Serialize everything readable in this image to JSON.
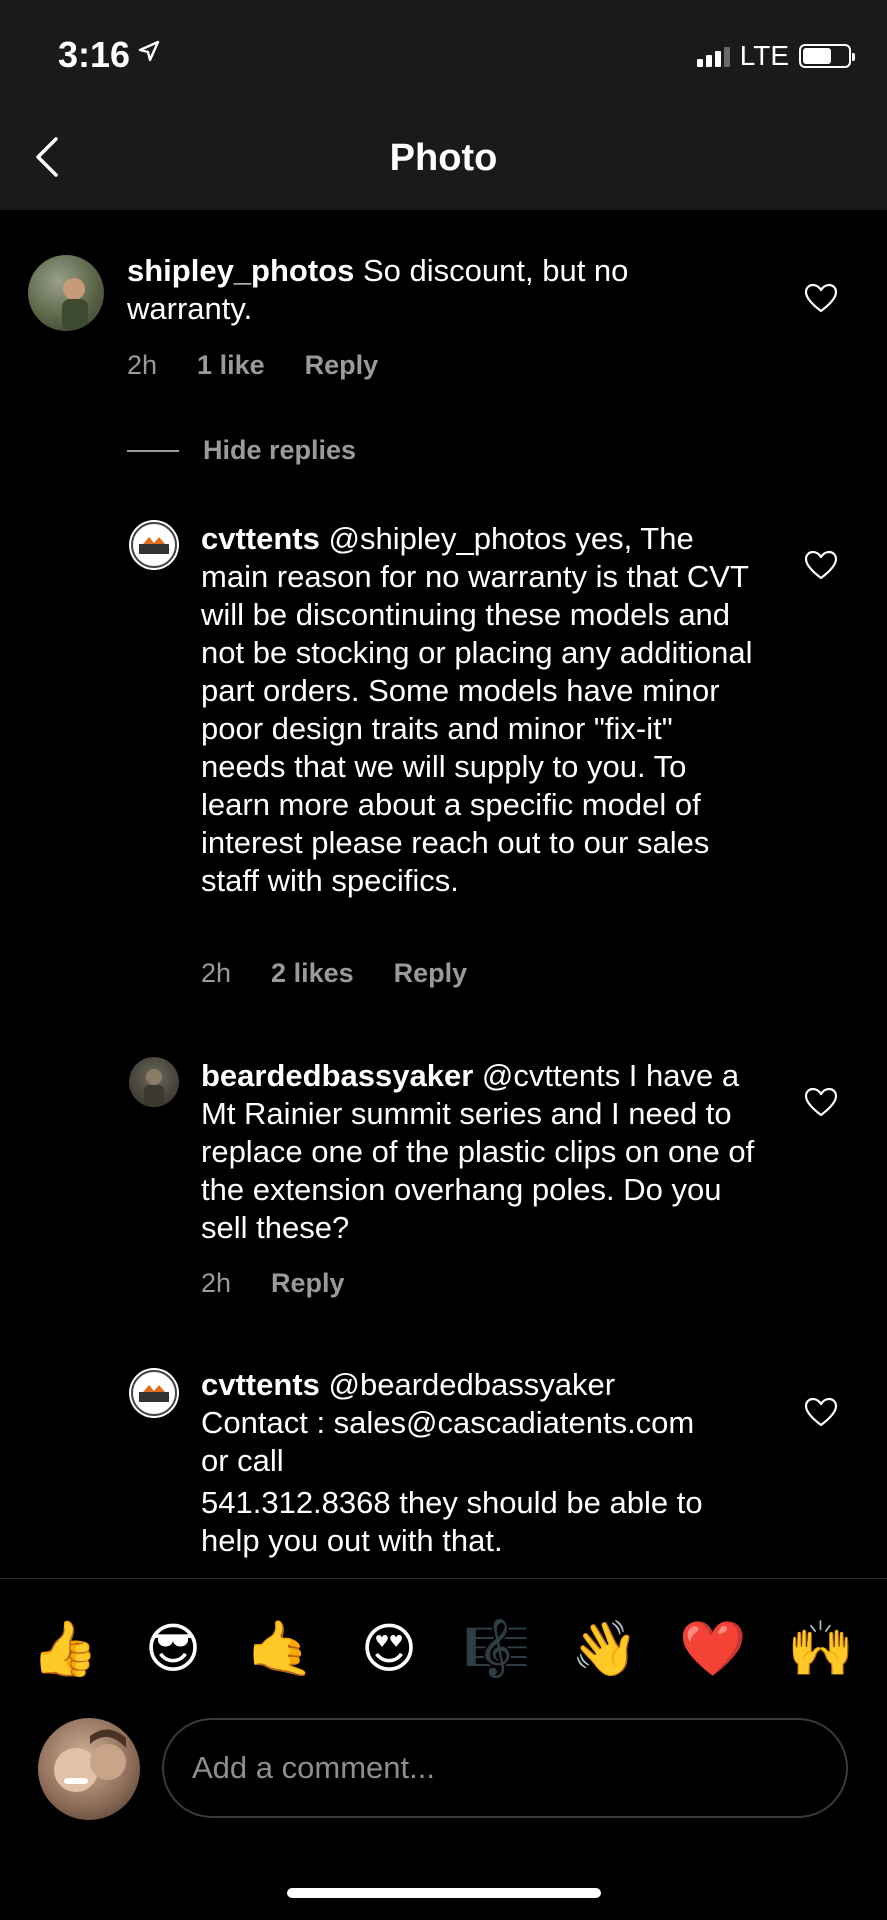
{
  "status_bar": {
    "time": "3:16",
    "network": "LTE"
  },
  "nav": {
    "title": "Photo"
  },
  "comments": [
    {
      "username": "shipley_photos",
      "text": "So discount, but no warranty.",
      "time": "2h",
      "likes": "1 like",
      "reply": "Reply"
    },
    {
      "username": "cvttents",
      "text": "@shipley_photos yes, The main reason for no warranty is that CVT will be discontinuing these models and not be stocking or placing any additional part orders. Some models have minor poor design traits and minor \"fix-it\" needs that we will supply to you. To learn more about a specific model of interest please reach out to our sales staff with specifics.",
      "time": "2h",
      "likes": "2 likes",
      "reply": "Reply"
    },
    {
      "username": "beardedbassyaker",
      "text": "@cvttents I have a Mt Rainier summit series and I need to replace one of the plastic clips on one of the extension overhang poles. Do you sell these?",
      "time": "2h",
      "reply": "Reply"
    },
    {
      "username": "cvttents",
      "text_line1": "@beardedbassyaker",
      "text_line2": "Contact : sales@cascadiatents.com",
      "text_line3": "or call",
      "text_line4": "541.312.8368 they should be able to help you out with that."
    }
  ],
  "hide_replies": "Hide replies",
  "avatar_logo_text": "CVT",
  "emojis": [
    "👍",
    "😎",
    "🤙",
    "😍",
    "🎼",
    "👋",
    "❤️",
    "🙌"
  ],
  "comment_input": {
    "placeholder": "Add a comment..."
  }
}
